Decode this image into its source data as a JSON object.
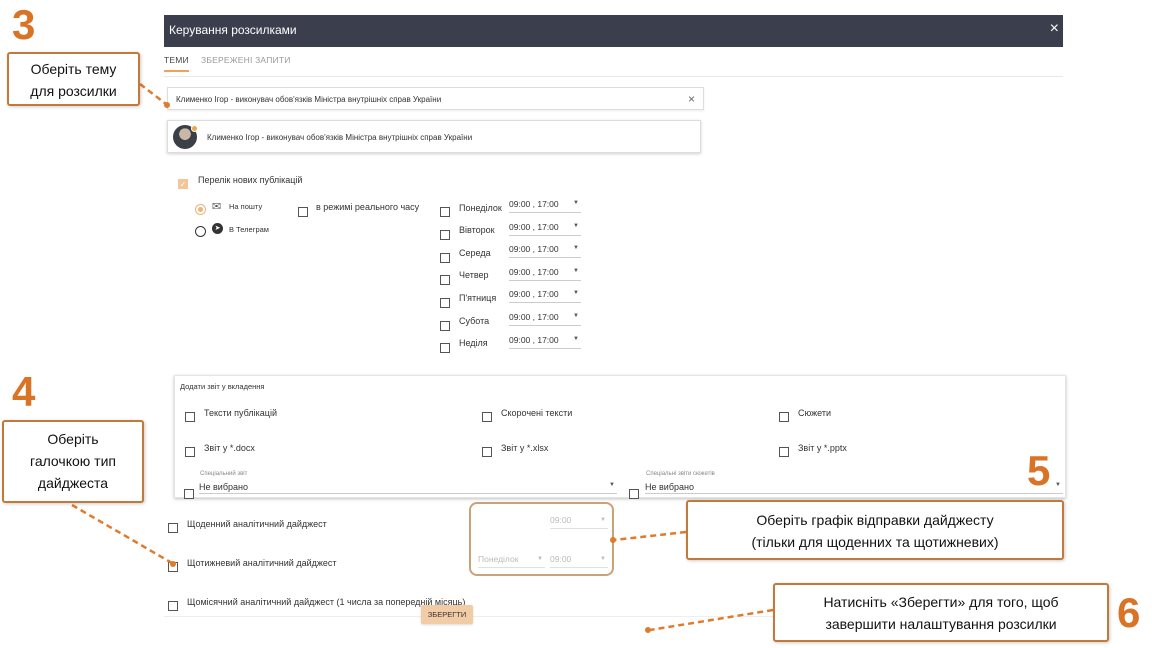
{
  "modal": {
    "title": "Керування розсилками",
    "close_icon": "×",
    "tabs": [
      {
        "label": "ТЕМИ",
        "active": true
      },
      {
        "label": "ЗБЕРЕЖЕНІ ЗАПИТИ",
        "active": false
      }
    ],
    "topic_input": {
      "value": "Клименко Ігор - виконувач обов'язків Міністра внутрішніх справ України",
      "clear_icon": "×"
    },
    "topic_card": {
      "text": "Клименко Ігор - виконувач обов'язків Міністра внутрішніх справ України"
    },
    "new_publications": {
      "label": "Перелік нових публікацій",
      "checked": true
    },
    "delivery": {
      "email_label": "На пошту",
      "telegram_label": "В Телеграм",
      "realtime_label": "в режимі реального часу",
      "selected": "email"
    },
    "days": [
      {
        "label": "Понеділок",
        "times": "09:00 , 17:00"
      },
      {
        "label": "Вівторок",
        "times": "09:00 , 17:00"
      },
      {
        "label": "Середа",
        "times": "09:00 , 17:00"
      },
      {
        "label": "Четвер",
        "times": "09:00 , 17:00"
      },
      {
        "label": "П'ятниця",
        "times": "09:00 , 17:00"
      },
      {
        "label": "Субота",
        "times": "09:00 , 17:00"
      },
      {
        "label": "Неділя",
        "times": "09:00 , 17:00"
      }
    ],
    "reports": {
      "title": "Додати звіт у вкладення",
      "options": [
        "Тексти публікацій",
        "Скорочені тексти",
        "Сюжети",
        "Звіт у *.docx",
        "Звіт у *.xlsx",
        "Звіт у *.pptx"
      ],
      "special_hint": "Спеціальний звіт",
      "special_value": "Не вибрано",
      "story_hint": "Спеціальні звіти сюжетів",
      "story_value": "Не вибрано"
    },
    "digests": {
      "daily": {
        "label": "Щоденний аналітичний дайджест",
        "time": "09:00"
      },
      "weekly": {
        "label": "Щотижневий аналітичний дайджест",
        "day": "Понеділок",
        "time": "09:00"
      },
      "monthly": {
        "label": "Щомісячний аналітичний дайджест (1 числа за попередній місяць)"
      }
    },
    "save_label": "ЗБЕРЕГТИ"
  },
  "annotations": {
    "step3": {
      "number": "3",
      "text_line1": "Оберіть тему",
      "text_line2": "для розсилки"
    },
    "step4": {
      "number": "4",
      "text_line1": "Оберіть",
      "text_line2": "галочкою тип",
      "text_line3": "дайджеста"
    },
    "step5": {
      "number": "5",
      "text_line1": "Оберіть графік відправки дайджесту",
      "text_line2": "(тільки для щоденних та щотижневих)"
    },
    "step6": {
      "number": "6",
      "text_line1": "Натисніть «Зберегти» для того, щоб",
      "text_line2": "завершити налаштування розсилки"
    }
  },
  "colors": {
    "titlebar": "#3b3e4d",
    "accent": "#f0a25a",
    "annotation": "#d97326"
  }
}
